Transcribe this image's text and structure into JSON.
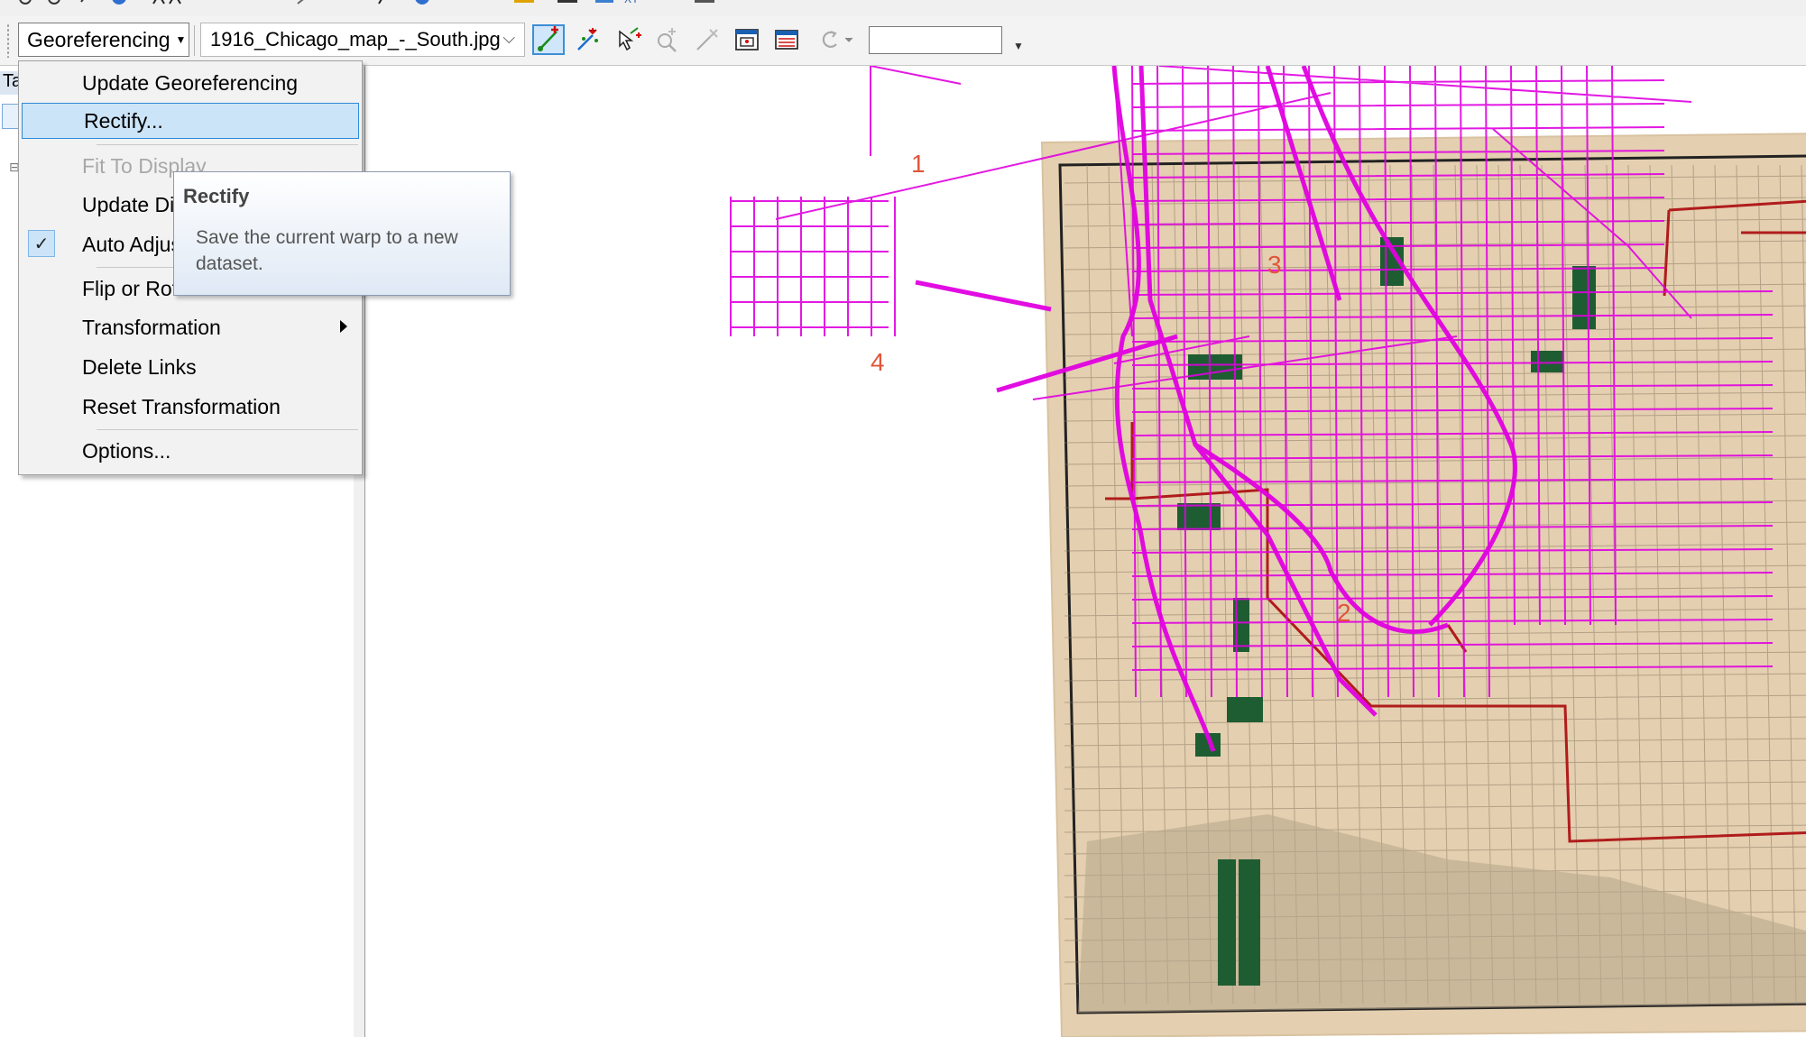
{
  "toolbar": {
    "georeferencing_label": "Georeferencing",
    "layer_select_value": "1916_Chicago_map_-_South.jpg",
    "scale_value": "",
    "buttons": [
      {
        "name": "add-control-points",
        "icon": "add-control-points-icon",
        "active": true
      },
      {
        "name": "auto-registration",
        "icon": "auto-registration-icon"
      },
      {
        "name": "select-link",
        "icon": "select-link-icon"
      },
      {
        "name": "zoom-to-selected-link",
        "icon": "zoom-link-icon"
      },
      {
        "name": "delete-link",
        "icon": "delete-link-icon"
      },
      {
        "name": "viewer",
        "icon": "viewer-icon"
      },
      {
        "name": "link-table",
        "icon": "link-table-icon"
      },
      {
        "name": "rotate",
        "icon": "rotate-icon"
      }
    ]
  },
  "toc": {
    "header_label": "Ta"
  },
  "menu": {
    "items": [
      {
        "label": "Update Georeferencing"
      },
      {
        "label": "Rectify..."
      },
      {
        "label": "Fit To Display"
      },
      {
        "label": "Update Display"
      },
      {
        "label": "Auto Adjust",
        "checked": true
      },
      {
        "label": "Flip or Rotate"
      },
      {
        "label": "Transformation"
      },
      {
        "label": "Delete Links"
      },
      {
        "label": "Reset Transformation"
      },
      {
        "label": "Options..."
      }
    ]
  },
  "tooltip": {
    "title": "Rectify",
    "body": "Save the current warp to a new dataset."
  },
  "map": {
    "control_point_labels": [
      "1",
      "2",
      "3",
      "4"
    ],
    "colors": {
      "paper": "#e4cfb0",
      "roads_overlay": "#e000e0",
      "parks": "#1e5d32",
      "boundary": "#b01c1c",
      "labels": "#e0563a"
    }
  }
}
